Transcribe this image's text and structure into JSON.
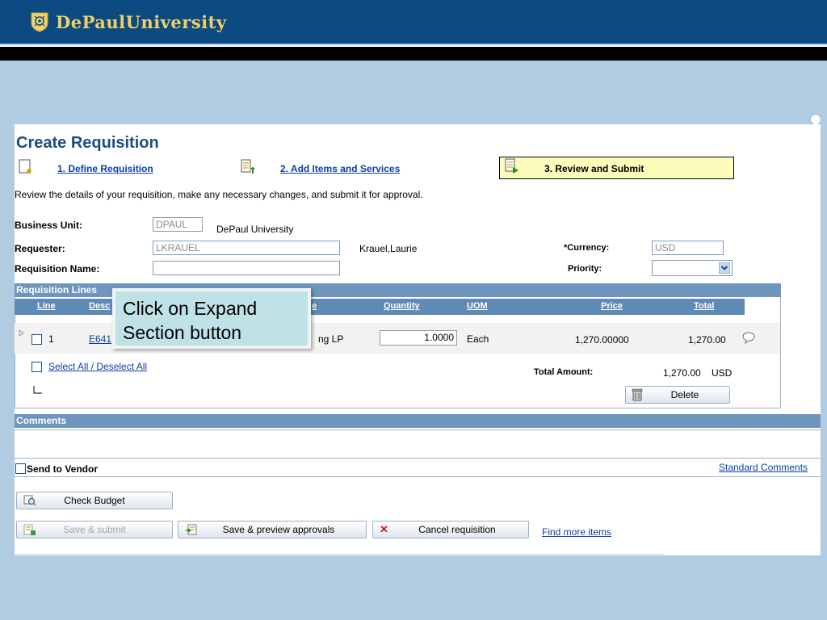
{
  "header": {
    "university_name": "DePaulUniversity",
    "logo": "depaul-seal-icon"
  },
  "page": {
    "title": "Create Requisition",
    "instructions": "Review the details of your requisition, make any necessary changes, and submit it for approval."
  },
  "train": {
    "step1": "1. Define Requisition",
    "step2": "2. Add Items and Services",
    "step3": "3. Review and Submit"
  },
  "form": {
    "business_unit_label": "Business Unit:",
    "business_unit_value": "DPAUL",
    "business_unit_desc": "DePaul University",
    "requester_label": "Requester:",
    "requester_value": "LKRAUEL",
    "requester_name": "Krauel,Laurie",
    "req_name_label": "Requisition Name:",
    "req_name_value": "",
    "currency_label": "*Currency:",
    "currency_value": "USD",
    "priority_label": "Priority:",
    "priority_value": ""
  },
  "lines": {
    "section_title": "Requisition Lines",
    "headers": {
      "line": "Line",
      "description": "Desc",
      "supplier": "e",
      "quantity": "Quantity",
      "uom": "UOM",
      "price": "Price",
      "total": "Total"
    },
    "rows": [
      {
        "line": "1",
        "description": "E641",
        "supplier": "ng LP",
        "quantity": "1.0000",
        "uom": "Each",
        "price": "1,270.00000",
        "total": "1,270.00"
      }
    ],
    "select_all": "Select All / Deselect All",
    "total_amount_label": "Total Amount:",
    "total_amount_value": "1,270.00",
    "total_currency": "USD",
    "delete_label": "Delete"
  },
  "comments": {
    "section_title": "Comments",
    "send_to_vendor": "Send to Vendor",
    "standard_comments": "Standard Comments"
  },
  "actions": {
    "check_budget": "Check Budget",
    "save_submit": "Save & submit",
    "save_preview": "Save & preview approvals",
    "cancel": "Cancel requisition",
    "find_more": "Find more items"
  },
  "callout": {
    "line1": "Click on Expand",
    "line2": "Section button"
  },
  "colors": {
    "header_bg": "#0d4a82",
    "logo_gold": "#f0d169",
    "page_bg": "#b1cbe0",
    "section_bar": "#6d95bd",
    "title": "#1c4d82"
  }
}
